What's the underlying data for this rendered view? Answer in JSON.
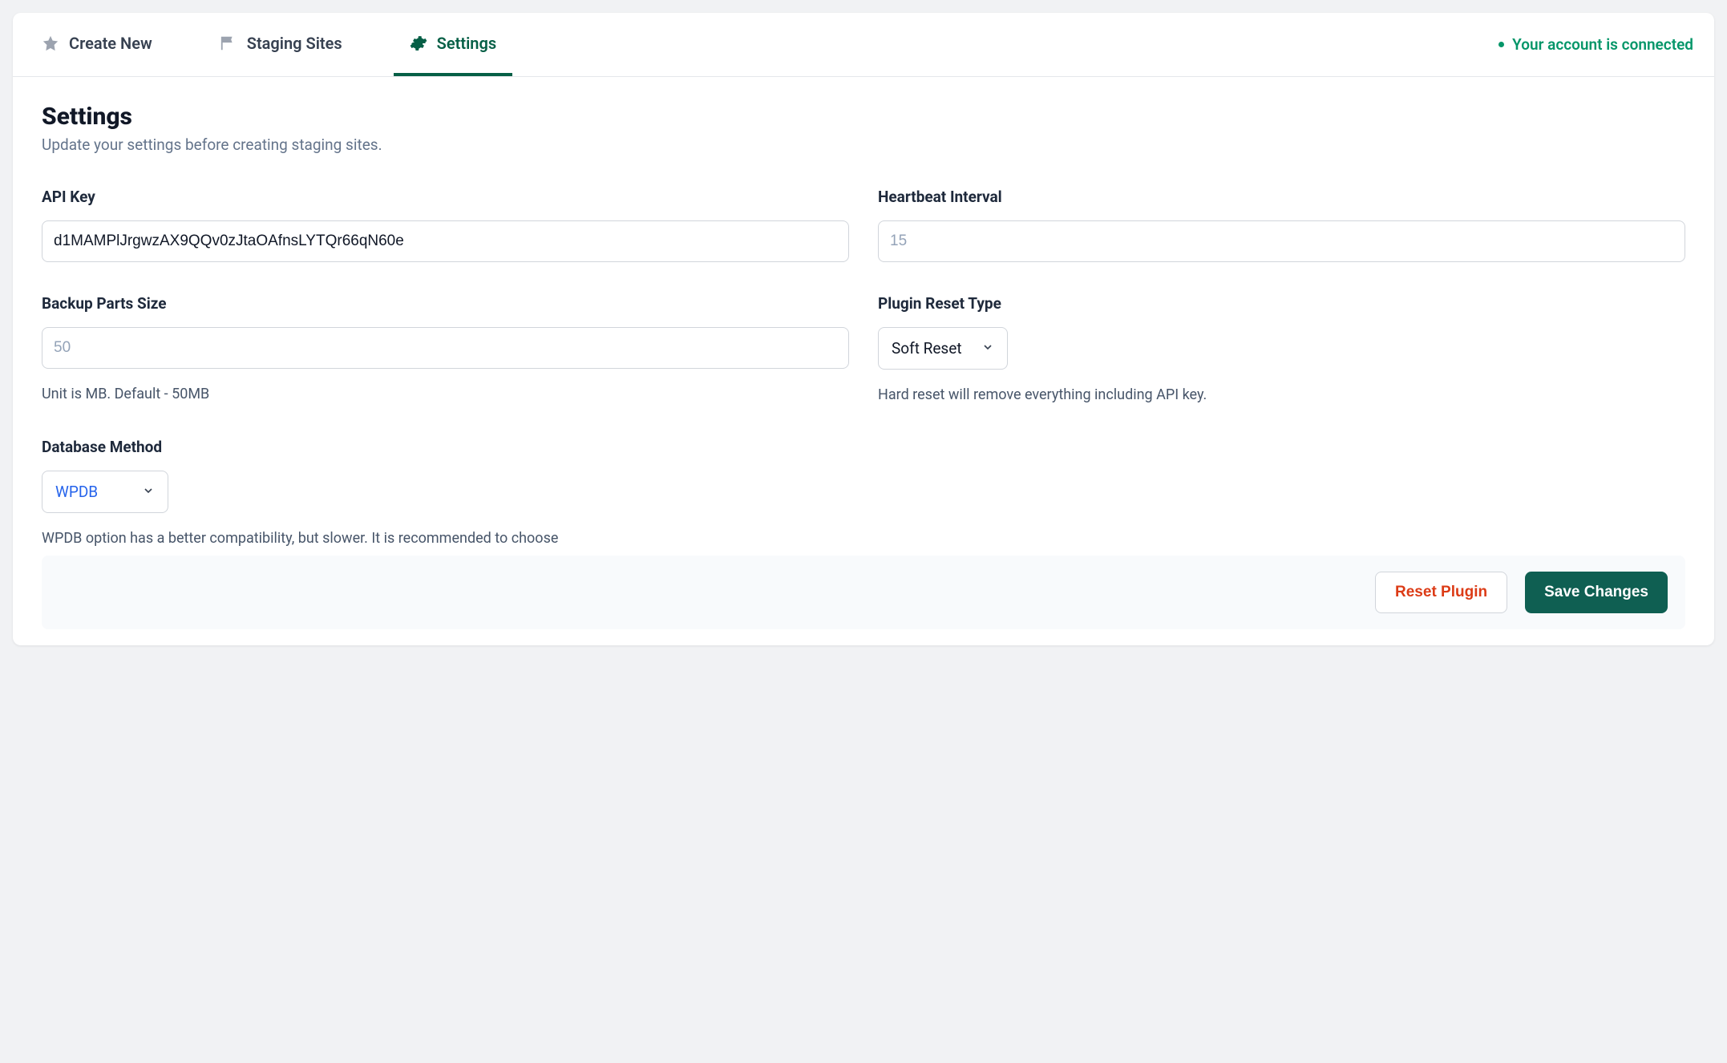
{
  "tabs": {
    "create": "Create New",
    "staging": "Staging Sites",
    "settings": "Settings"
  },
  "status": {
    "text": "Your account is connected"
  },
  "page": {
    "title": "Settings",
    "subtitle": "Update your settings before creating staging sites."
  },
  "fields": {
    "api_key": {
      "label": "API Key",
      "value": "d1MAMPlJrgwzAX9QQv0zJtaOAfnsLYTQr66qN60e"
    },
    "heartbeat": {
      "label": "Heartbeat Interval",
      "placeholder": "15"
    },
    "backup": {
      "label": "Backup Parts Size",
      "placeholder": "50",
      "help": "Unit is MB. Default - 50MB"
    },
    "reset_type": {
      "label": "Plugin Reset Type",
      "value": "Soft Reset",
      "help": "Hard reset will remove everything including API key."
    },
    "db_method": {
      "label": "Database Method",
      "value": "WPDB",
      "help": "WPDB option has a better compatibility, but slower. It is recommended to choose"
    }
  },
  "buttons": {
    "reset": "Reset Plugin",
    "save": "Save Changes"
  }
}
